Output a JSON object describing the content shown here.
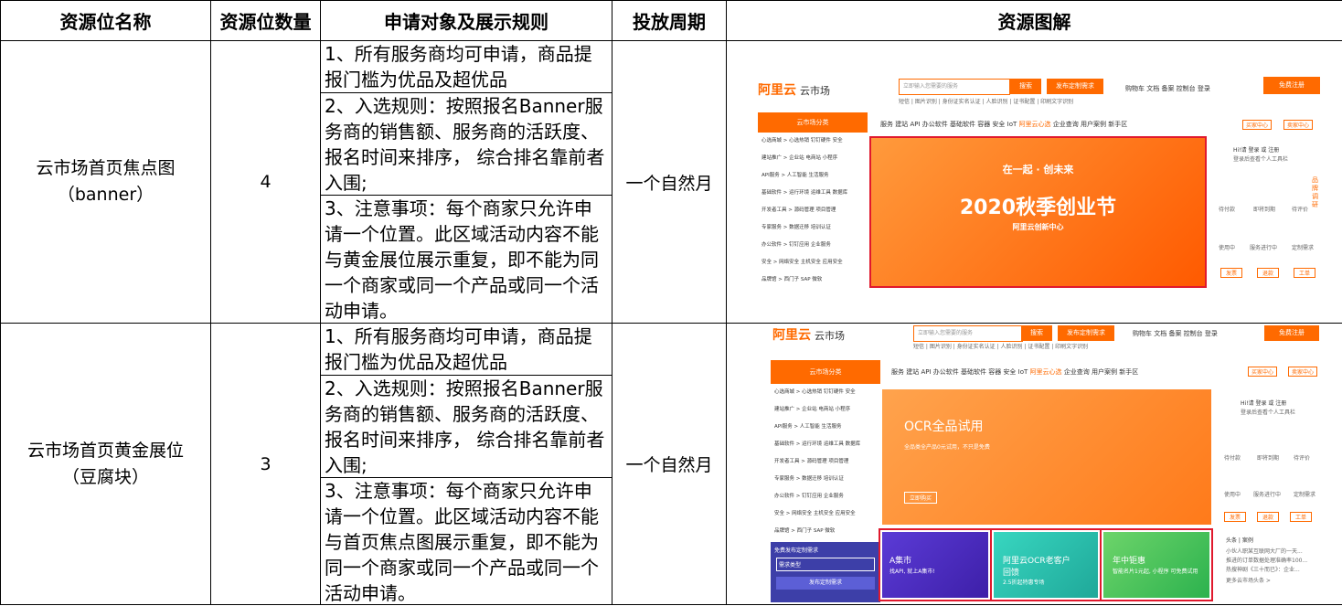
{
  "headers": [
    "资源位名称",
    "资源位数量",
    "申请对象及展示规则",
    "投放周期",
    "资源图解"
  ],
  "rows": [
    {
      "name_line1": "云市场首页焦点图",
      "name_line2": "（banner）",
      "qty": "4",
      "period": "一个自然月",
      "rules": [
        "1、所有服务商均可申请，商品提报门槛为优品及超优品",
        "2、入选规则：按照报名Banner服务商的销售额、服务商的活跃度、报名时间来排序， 综合排名靠前者入围;",
        "3、注意事项：每个商家只允许申请一个位置。此区域活动内容不能与黄金展位展示重复，即不能为同一个商家或同一个产品或同一个活动申请。"
      ]
    },
    {
      "name_line1": "云市场首页黄金展位",
      "name_line2": "（豆腐块）",
      "qty": "3",
      "period": "一个自然月",
      "rules": [
        "1、所有服务商均可申请，商品提报门槛为优品及超优品",
        "2、入选规则：按照报名Banner服务商的销售额、服务商的活跃度、报名时间来排序， 综合排名靠前者入围;",
        "3、注意事项：每个商家只允许申请一个位置。此区域活动内容不能与首页焦点图展示重复，即不能为同一个商家或同一个产品或同一个活动申请。"
      ]
    }
  ],
  "shot": {
    "logo": "阿里云",
    "logo_sub": "云市场",
    "search_placeholder": "立即输入您需要的服务",
    "search_btn": "搜索",
    "custom_btn": "发布定制需求",
    "top_links": "购物车  文档  备案  控制台  登录",
    "register_btn": "免费注册",
    "hot_words": "短信 | 图片识别 | 身份证实名认证 | 人脸识别 | 证书配置 | 印刷文字识别",
    "nav": "服务  建站  API  办公软件  基础软件  容器  安全  IoT",
    "nav_highlight": "阿里云心选",
    "nav_tail": "企业查询  用户案例  新手区",
    "side_header": "云市场分类",
    "side_items": [
      "心选商城 > 心选热销 钉钉硬件 安全",
      "建站推广 > 企业站 电商站 小程序",
      "API服务 > 人工智能 生活服务",
      "基础软件 > 运行环境 运维工具 数据库",
      "开发者工具 > 源码管理 项目管理",
      "专家服务 > 数据迁移 培训认证",
      "办公软件 > 钉钉应用 企业服务",
      "安全 > 网络安全 主机安全 应用安全",
      "品牌馆 > 西门子 SAP 微软"
    ],
    "banner_top": "在一起 · 创未来",
    "banner_title": "2020秋季创业节",
    "banner_sub": "阿里云创新中心",
    "ocr_title": "OCR全品试用",
    "ocr_sub": "全品类全产品0元试用，不只是免费",
    "ocr_btn": "立即购买",
    "tile1_title": "A集市",
    "tile1_sub": "找API, 就上A集市!",
    "tile2_title": "阿里云OCR老客户回馈",
    "tile2_sub": "2.5折起特惠专场",
    "tile3_title": "年中钜惠",
    "tile3_sub": "智能名片1元起, 小程序 可免费试用",
    "user_hi": "Hi!请 登录 或 注册",
    "user_sub": "登录后查看个人工具栏",
    "tools": [
      "待付款",
      "即将到期",
      "待评价",
      "使用中",
      "服务进行中",
      "定制需求"
    ],
    "pill_btns": [
      "发票",
      "退款",
      "工单"
    ],
    "side_tab": "品牌调研",
    "buy_center": "买家中心",
    "sell_center": "卖家中心",
    "free_req": "免费发布定制需求",
    "req_type": "需求类型",
    "pub_req": "发布定制需求",
    "news_head": "头条 | 案例",
    "news_lines": [
      "小伙人职某互联网大厂的一天...",
      "推进的订单数据处理准确率100...",
      "热搜神剧《三十而已》：企业...",
      "更多云市场头条 >"
    ]
  }
}
